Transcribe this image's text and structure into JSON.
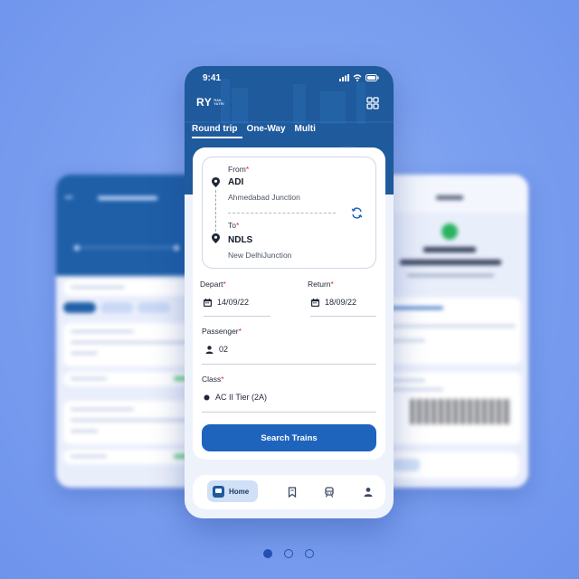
{
  "status": {
    "time": "9:41"
  },
  "brand": {
    "logo": "RY",
    "sub_top": "RAIL",
    "sub_bottom": "YATRI"
  },
  "tabs": [
    {
      "label": "Round trip",
      "active": true
    },
    {
      "label": "One-Way",
      "active": false
    },
    {
      "label": "Multi",
      "active": false
    }
  ],
  "from": {
    "label": "From",
    "code": "ADI",
    "city": "Ahmedabad Junction"
  },
  "to": {
    "label": "To",
    "code": "NDLS",
    "city": "New DelhiJunction"
  },
  "depart": {
    "label": "Depart",
    "value": "14/09/22"
  },
  "return": {
    "label": "Return",
    "value": "18/09/22"
  },
  "passenger": {
    "label": "Passenger",
    "value": "02"
  },
  "class": {
    "label": "Class",
    "value": "AC II Tier (2A)"
  },
  "search_button": "Search Trains",
  "nav": {
    "home": "Home"
  },
  "required_mark": "*",
  "carousel": {
    "pages": 3,
    "active": 1
  },
  "colors": {
    "primary": "#1e5a9c",
    "button": "#1e64bd",
    "required": "#e0263a"
  }
}
